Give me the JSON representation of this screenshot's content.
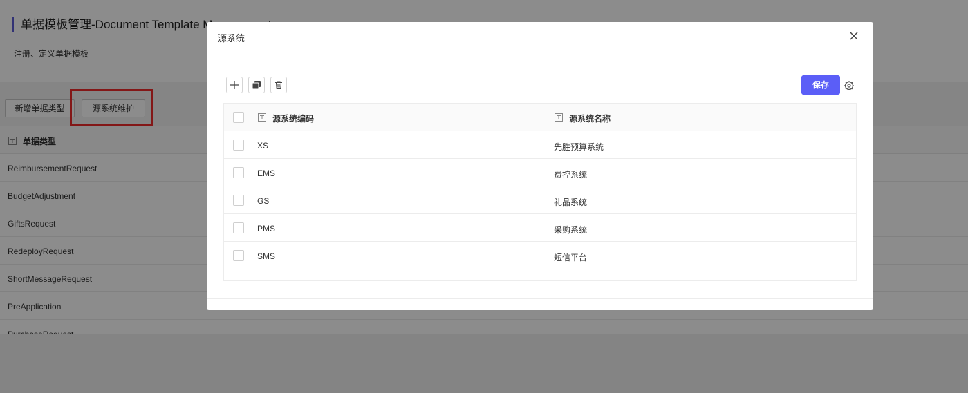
{
  "page": {
    "title": "单据模板管理-Document Template Management",
    "subtitle": "注册、定义单据模板"
  },
  "toolbar": {
    "add_type_label": "新增单据类型",
    "maintain_label": "源系统维护"
  },
  "bg_table": {
    "header": "单据类型",
    "rows": [
      "ReimbursementRequest",
      "BudgetAdjustment",
      "GiftsRequest",
      "RedeployRequest",
      "ShortMessageRequest",
      "PreApplication",
      "PurchaseRequest"
    ]
  },
  "modal": {
    "title": "源系统",
    "save_label": "保存",
    "columns": [
      "源系统编码",
      "源系统名称"
    ],
    "rows": [
      {
        "code": "XS",
        "name": "先胜预算系统"
      },
      {
        "code": "EMS",
        "name": "费控系统"
      },
      {
        "code": "GS",
        "name": "礼品系统"
      },
      {
        "code": "PMS",
        "name": "采购系统"
      },
      {
        "code": "SMS",
        "name": "短信平台"
      }
    ]
  },
  "colors": {
    "accent": "#5b5ef7",
    "highlight": "#ee2a2a"
  }
}
